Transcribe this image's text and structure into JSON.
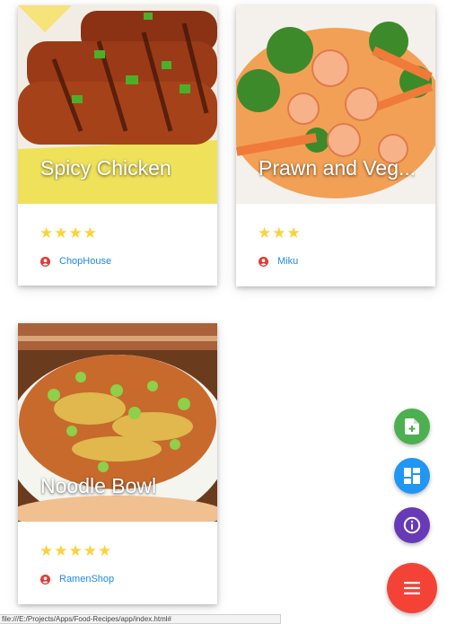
{
  "cards": [
    {
      "title": "Spicy Chicken",
      "rating": 4,
      "stars": "★★★★",
      "author": "ChopHouse",
      "image": "grilled-chicken-photo"
    },
    {
      "title": "Prawn and Veg...",
      "rating": 3,
      "stars": "★★★",
      "author": "Miku",
      "image": "prawn-vegetable-photo"
    },
    {
      "title": "Noodle Bowl",
      "rating": 5,
      "stars": "★★★★★",
      "author": "RamenShop",
      "image": "noodle-bowl-photo"
    }
  ],
  "fabs": [
    {
      "name": "add-recipe-fab",
      "icon": "add-document-icon",
      "color": "#4caf50"
    },
    {
      "name": "dashboard-fab",
      "icon": "dashboard-icon",
      "color": "#2196f3"
    },
    {
      "name": "info-fab",
      "icon": "info-icon",
      "color": "#673ab7"
    },
    {
      "name": "menu-fab",
      "icon": "menu-icon",
      "color": "#f44336"
    }
  ],
  "status_bar": {
    "text": "file:///E:/Projects/Apps/Food-Recipes/app/index.html#"
  }
}
